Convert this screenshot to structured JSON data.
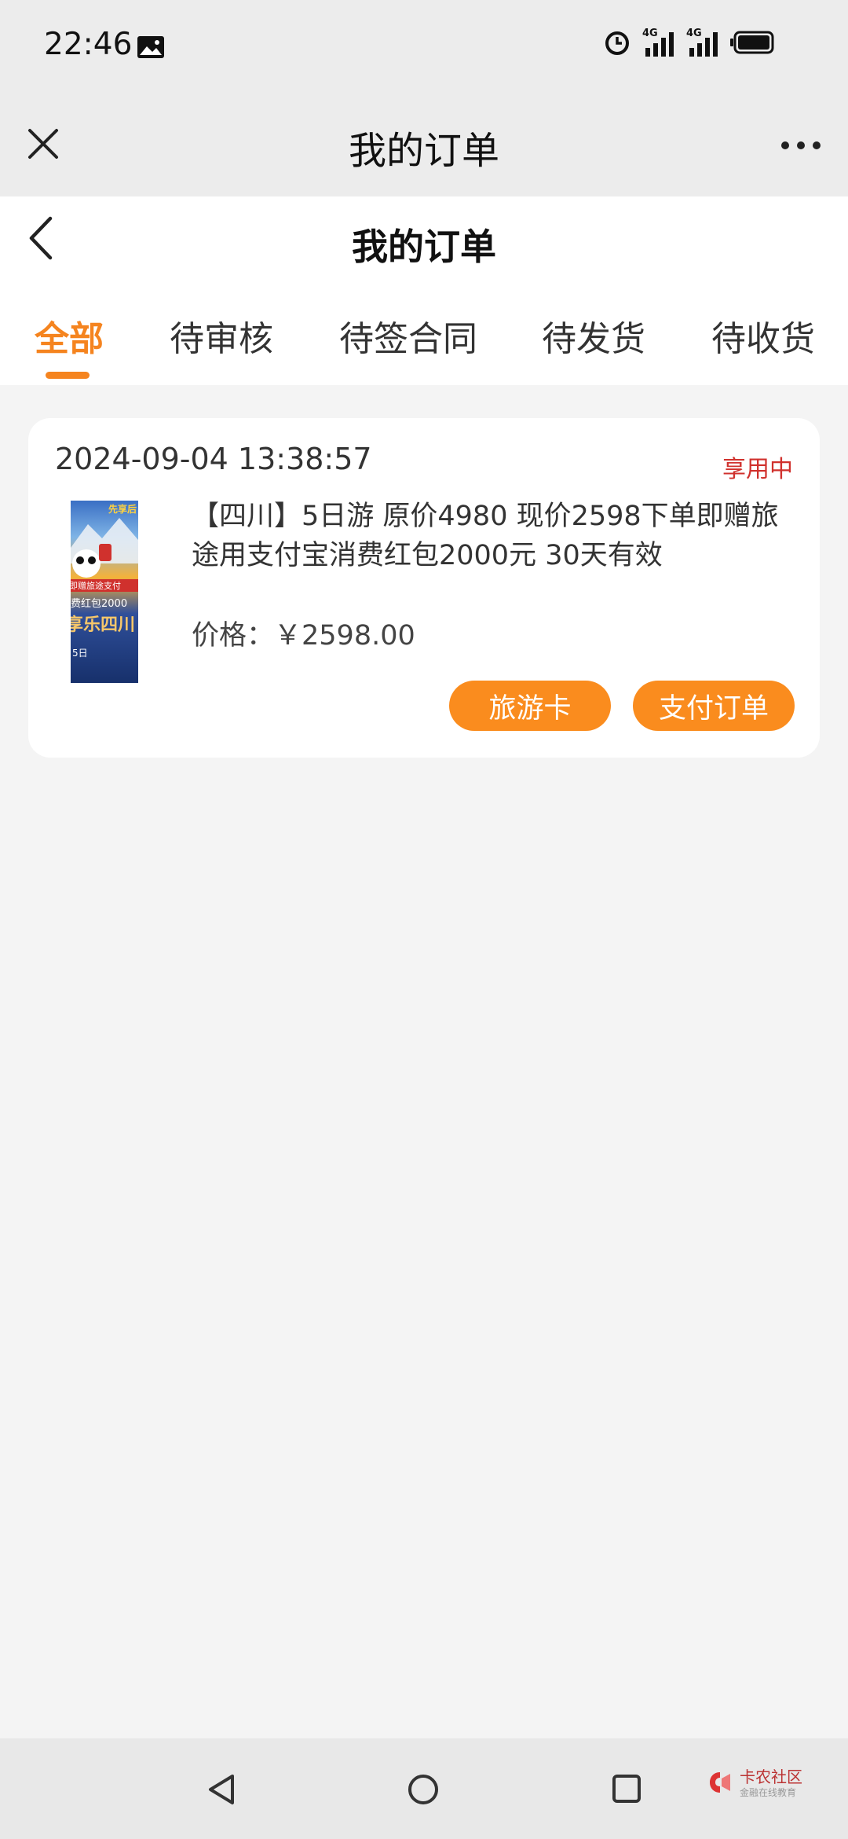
{
  "status_bar": {
    "time": "22:46",
    "signal_labels": [
      "4G",
      "4G"
    ],
    "icons": [
      "image-icon",
      "alarm-icon",
      "signal-4g-icon",
      "signal-4g-icon",
      "battery-icon"
    ]
  },
  "topbar": {
    "title": "我的订单",
    "icons": [
      "close-icon",
      "more-icon"
    ]
  },
  "header": {
    "title": "我的订单",
    "back_icon": "chevron-left-icon"
  },
  "tabs": [
    {
      "label": "全部",
      "active": true
    },
    {
      "label": "待审核",
      "active": false
    },
    {
      "label": "待签合同",
      "active": false
    },
    {
      "label": "待发货",
      "active": false
    },
    {
      "label": "待收货",
      "active": false
    }
  ],
  "order": {
    "datetime": "2024-09-04 13:38:57",
    "status": "享用中",
    "title": "【四川】5日游 原价4980 现价2598下单即赠旅途用支付宝消费红包2000元 30天有效",
    "price_label": "价格：",
    "price_value": "￥2598.00",
    "buttons": {
      "travel_card": "旅游卡",
      "pay": "支付订单"
    },
    "thumbnail_texts": [
      "先享后",
      "即赠旅途支付",
      "费红包2000",
      "享乐四川",
      "5日"
    ]
  },
  "navbar": {
    "icons": [
      "back-triangle-icon",
      "home-circle-icon",
      "recent-square-icon"
    ],
    "watermark_title": "卡农社区",
    "watermark_sub": "金融在线教育"
  },
  "colors": {
    "accent": "#f5841f",
    "button": "#fa8c1e",
    "status_red": "#d0312d",
    "background": "#f4f4f4"
  }
}
